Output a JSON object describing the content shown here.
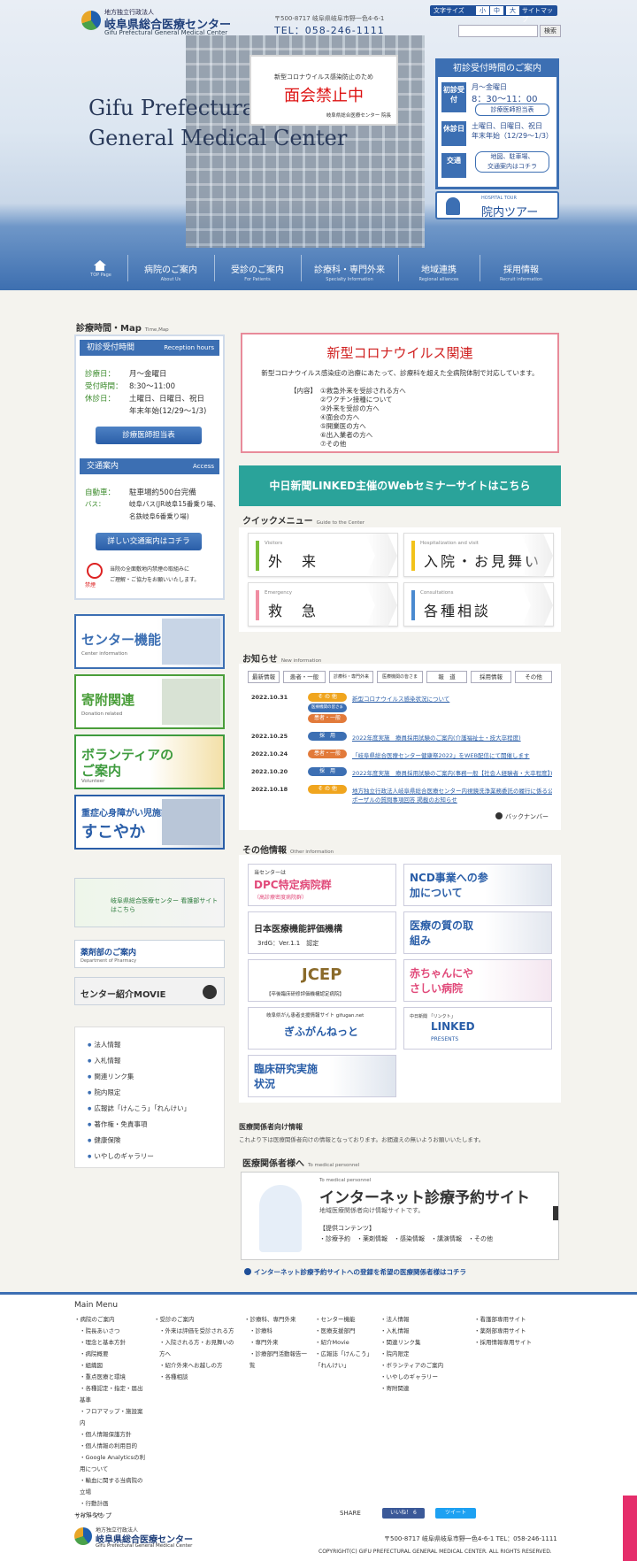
{
  "header": {
    "logo_small": "地方独立行政法人",
    "logo_name": "岐阜県総合医療センター",
    "logo_en": "Gifu Prefectural General Medical Center",
    "address": "〒500-8717 岐阜県岐阜市野一色4-6-1",
    "tel": "TEL：058-246-1111",
    "title_line1": "Gifu Prefectural",
    "title_line2": "General Medical Center",
    "font_size_label": "文字サイズ",
    "font_sizes": [
      "小",
      "中",
      "大"
    ],
    "sitemap_label": "サイトマップ",
    "search_button": "検索",
    "notice": {
      "small": "新型コロナウイルス感染防止のため",
      "big": "面会禁止中",
      "sign": "岐阜県総合医療センター 院長"
    }
  },
  "hours_box": {
    "heading": "初診受付時間のご案内",
    "reception_label": "初診受付",
    "days": "月〜金曜日",
    "time": "8：30〜11：00",
    "doctor_btn": "診療医師担当表",
    "closed_label": "休診日",
    "closed_text1": "土曜日、日曜日、祝日",
    "closed_text2": "年末年始（12/29〜1/3）",
    "traffic_label": "交通",
    "traffic_btn1": "地図、駐車場、",
    "traffic_btn2": "交通案内はコチラ",
    "tour_en": "HOSPITAL TOUR",
    "tour_ja": "院内ツアー"
  },
  "nav": [
    {
      "label": "",
      "sub": "TOP Page"
    },
    {
      "label": "病院のご案内",
      "sub": "About Us"
    },
    {
      "label": "受診のご案内",
      "sub": "For Patients"
    },
    {
      "label": "診療科・専門外来",
      "sub": "Specialty Information"
    },
    {
      "label": "地域連携",
      "sub": "Regional alliances"
    },
    {
      "label": "採用情報",
      "sub": "Recruit information"
    }
  ],
  "left": {
    "section_title": "診療時間・Map",
    "section_sub": "Time,Map",
    "rec_heading": "初診受付時間",
    "rec_heading_en": "Reception hours",
    "rows": [
      {
        "k": "診療日：",
        "v": "月〜金曜日"
      },
      {
        "k": "受付時間：",
        "v": "8:30〜11:00"
      },
      {
        "k": "休診日：",
        "v": "土曜日、日曜日、祝日"
      },
      {
        "k": "",
        "v": "年末年始(12/29〜1/3)"
      }
    ],
    "doctor_btn": "診療医師担当表",
    "access_heading": "交通案内",
    "access_heading_en": "Access",
    "parking_k": "自動車：",
    "parking_v": "駐車場約500台完備",
    "bus_k": "バス：",
    "bus_v1": "岐阜バス(JR岐阜15番乗り場、",
    "bus_v2": "名鉄岐阜6番乗り場)",
    "access_btn": "詳しい交通案内はコチラ",
    "smoke_label": "禁煙",
    "smoke1": "当院の全面敷地内禁煙の取組みに",
    "smoke2": "ご理解・ご協力をお願いいたします。",
    "banners": [
      {
        "t": "センター機能",
        "s": "Center information",
        "color": "#3c6fb3"
      },
      {
        "t": "寄附関連",
        "s": "Donation related",
        "color": "#4a9e3a"
      },
      {
        "t": "ボランティアの",
        "t2": "ご案内",
        "s": "Volunteer",
        "color": "#3e9b3e"
      },
      {
        "t": "重症心身障がい児施設",
        "t2": "すこやか",
        "s": "",
        "color": "#2a5ea8"
      }
    ],
    "nurse_banner": "岐阜県総合医療センター 看護部サイトはこちら",
    "pharmacy_banner": "薬剤部のご案内",
    "pharmacy_sub": "Department of Pharmacy",
    "movie_banner": "センター紹介MOVIE",
    "links": [
      "法人情報",
      "入札情報",
      "関連リンク集",
      "院内限定",
      "広報誌「けんこう」「れんけい」",
      "著作権・免責事項",
      "健康保険",
      "いやしのギャラリー"
    ]
  },
  "covid": {
    "heading": "新型コロナウイルス関連",
    "sub": "新型コロナウイルス感染症の治療にあたって、診療科を超えた全病院体制で対応しています。",
    "content_label": "【内容】",
    "items": [
      "①救急外来を受診される方へ",
      "②ワクチン接種について",
      "③外来を受診の方へ",
      "④面会の方へ",
      "⑤開業医の方へ",
      "⑥出入業者の方へ",
      "⑦その他"
    ]
  },
  "seminar": "中日新聞LINKED主催のWebセミナーサイトはこちら",
  "quick": {
    "title": "クイックメニュー",
    "sub": "Guide to the Center",
    "items": [
      {
        "en": "Visitors",
        "ja": "外　来",
        "color": "#7bbf3a"
      },
      {
        "en": "Hospitalization and visit",
        "ja": "入院・お見舞い",
        "color": "#f2c21a"
      },
      {
        "en": "Emergency",
        "ja": "救　急",
        "color": "#f08da2"
      },
      {
        "en": "Consultations",
        "ja": "各種相談",
        "color": "#4a8ad0"
      }
    ]
  },
  "news": {
    "title": "お知らせ",
    "sub": "New information",
    "tabs": [
      "最新情報",
      "患者・一般",
      "診療科・専門外来",
      "医療機関の皆さま",
      "報　道",
      "採用情報",
      "その他"
    ],
    "items": [
      {
        "date": "2022.10.31",
        "cat": "そ の 他",
        "color": "#f0a51e",
        "text": "新型コロナウイルス感染状況について"
      },
      {
        "date": "",
        "cat": "医療機関の皆さま",
        "color": "#3c6fb3",
        "text": ""
      },
      {
        "date": "",
        "cat": "患者・一般",
        "color": "#e27a3a",
        "text": ""
      },
      {
        "date": "2022.10.25",
        "cat": "採　用",
        "color": "#3c6fb3",
        "text": "2022年度実施　療員採用試験のご案内(介護福祉士・技大卒程度)"
      },
      {
        "date": "2022.10.24",
        "cat": "患者・一般",
        "color": "#e27a3a",
        "text": "「岐阜県総合医療センター健康祭2022」をWEB配信にて開催します"
      },
      {
        "date": "2022.10.20",
        "cat": "採　用",
        "color": "#3c6fb3",
        "text": "2022年度実施　療員採用試験のご案内(事務一般【社会人経験者・大卒程度】)"
      },
      {
        "date": "2022.10.18",
        "cat": "そ の 他",
        "color": "#f0a51e",
        "text": "地方独立行政法人岐阜県総合医療センター内視鏡洗浄業務委託の履行に係る公募型プロポーザルの実施",
        "text2": "ポーザルの質問事項回答 掲載のお知らせ"
      }
    ],
    "back": "バックナンバー"
  },
  "other": {
    "title": "その他情報",
    "sub": "Other information",
    "items": [
      {
        "t": "DPC特定病院群",
        "pre": "当センターは",
        "note": "（高診療密度病院群）"
      },
      {
        "t": "NCD事業への参加について"
      },
      {
        "t": "日本医療機能評価機構",
        "note": "3rdG：Ver.1.1　認定"
      },
      {
        "t": "医療の質の取組み"
      },
      {
        "t": "JCEP",
        "note": "【卒後臨床研修評価機構認定病院】"
      },
      {
        "t": "赤ちゃんにやさしい病院"
      },
      {
        "t": "ぎふがんねっと",
        "pre": "岐阜県がん患者支援情報サイト gifugan.net"
      },
      {
        "t": "LINKED",
        "pre": "中日新聞 「リンクト」",
        "note": "PRESENTS"
      },
      {
        "t": "臨床研究実施状況"
      }
    ]
  },
  "medical": {
    "title": "医療関係者向け情報",
    "desc": "これより下は医療関係者向けの情報となっております。お間違えの無いようお願いいたします。",
    "heading": "医療関係者様へ",
    "heading_sub": "To medical personnel",
    "rsv_en": "To medical personnel",
    "rsv_title": "インターネット診療予約サイト",
    "rsv_desc": "地域医療関係者向け情報サイトです。",
    "rsv_contents": "【提供コンテンツ】",
    "rsv_items": "・診療予約　・薬剤情報　・感染情報　・講演情報　・その他",
    "rsv_link": "インターネット診療予約サイトへの登録を希望の医療関係者様はコチラ"
  },
  "footer": {
    "main_menu": "Main Menu",
    "col1": [
      "病院のご案内",
      "院長あいさつ",
      "理念と基本方針",
      "病院概要",
      "組織図",
      "重点医療と環境",
      "各種認定・指定・届出基準",
      "フロアマップ・施設案内",
      "個人情報保護方針",
      "個人情報の利用目的",
      "Google Analyticsの利用について",
      "輸血に関する当病院の立場",
      "行動計画",
      "お知らせ"
    ],
    "col2": [
      "受診のご案内",
      "外来は評価を受診される方",
      "入院される方・お見舞いの方へ",
      "紹介外来へお越しの方",
      "各種相談"
    ],
    "col3": [
      "診療科、専門外来",
      "診療科",
      "専門外来",
      "診療部門活動報告一覧"
    ],
    "col4": [
      "センター機能",
      "医療支援部門",
      "紹介Movie",
      "広報誌「けんこう」「れんけい」"
    ],
    "col5": [
      "法人情報",
      "入札情報",
      "関連リンク集",
      "院内限定",
      "ボランティアのご案内",
      "いやしのギャラリー",
      "寄附関連"
    ],
    "col6": [
      "看護部専用サイト",
      "薬剤部専用サイト",
      "採用情報専用サイト"
    ],
    "sitemap": "サイトマップ",
    "share": "SHARE",
    "fb": "いいね！ 6",
    "tw": "ツイート",
    "address": "〒500-8717 岐阜県岐阜市野一色4-6-1  TEL：058-246-1111",
    "copyright": "COPYRIGHT(C) GIFU PREFECTURAL GENERAL MEDICAL CENTER. ALL RIGHTS RESERVED."
  }
}
